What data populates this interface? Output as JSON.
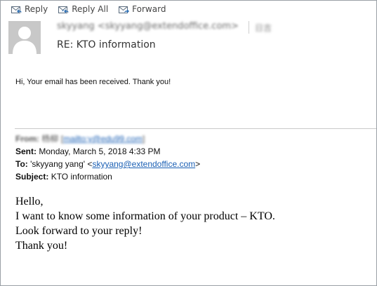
{
  "toolbar": {
    "reply_label": "Reply",
    "reply_all_label": "Reply All",
    "forward_label": "Forward"
  },
  "header": {
    "sender": "skyyang <skyyang@extendoffice.com>",
    "recipient": "日吉",
    "subject": "RE: KTO information"
  },
  "reply_body": {
    "text": "Hi, Your email has been received. Thank you!"
  },
  "quoted_header": {
    "from_label": "From:",
    "from_name": "杨柳",
    "from_link": "mailto:y@edu99.com",
    "sent_label": "Sent:",
    "sent_value": "Monday, March 5, 2018 4:33 PM",
    "to_label": "To:",
    "to_name": "'skyyang yang'",
    "to_link": "skyyang@extendoffice.com",
    "subject_label": "Subject:",
    "subject_value": "KTO information"
  },
  "original_message": {
    "lines": [
      "Hello,",
      "I want to know some information of your product – KTO.",
      "Look forward to your reply!",
      "Thank you!"
    ]
  },
  "colors": {
    "link": "#1a5fb4",
    "avatar_bg": "#c8c8c8"
  }
}
